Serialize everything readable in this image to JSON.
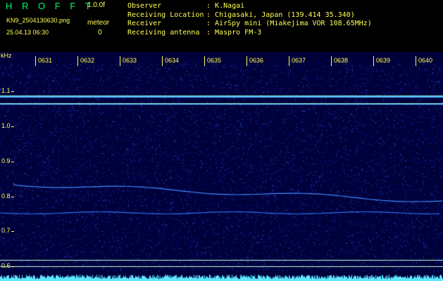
{
  "header": {
    "title": "H R O F F T",
    "version": "1.0.0f",
    "filename": "KN9_2504130630.png",
    "timestamp": "25.04.13 06:30",
    "meteor_label": "meteor",
    "meteor_count": "0",
    "info": [
      {
        "key": "Observer",
        "value": ": K.Nagai"
      },
      {
        "key": "Receiving Location",
        "value": ": Chigasaki, Japan (139.414 35.340)"
      },
      {
        "key": "Receiver",
        "value": ": AirSpy mini (Miakejima VOR 108.65MHz)"
      },
      {
        "key": "Receiving antenna",
        "value": ": Maspro FM-3"
      }
    ]
  },
  "spectrogram": {
    "y_unit": "kHz",
    "y_labels": [
      "1.1",
      "1.0",
      "0.9",
      "0.8",
      "0.7",
      "0.6"
    ],
    "time_labels": [
      "0631",
      "0632",
      "0633",
      "0634",
      "0635",
      "0636",
      "0637",
      "0638",
      "0639",
      "0640"
    ],
    "colors": {
      "background": "#00003a",
      "noise": "#1a3fd6",
      "signal": "#5fe8ff",
      "reference_line": "#c8ffe0",
      "label": "#ffff55"
    }
  }
}
